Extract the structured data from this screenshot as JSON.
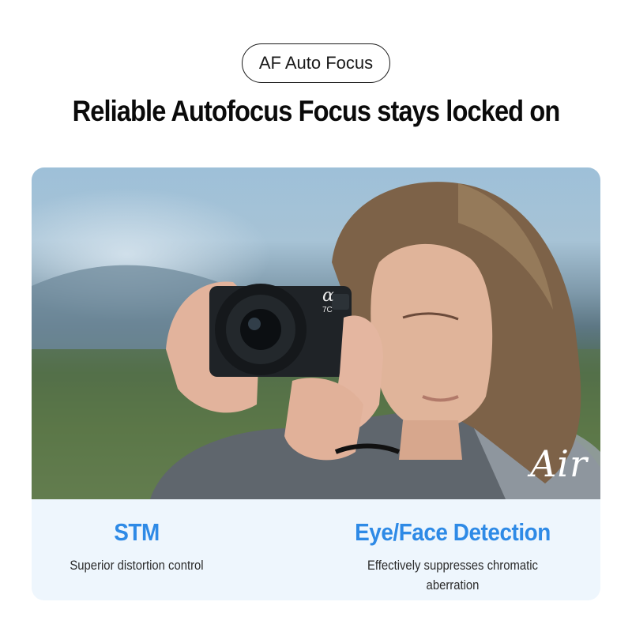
{
  "badge": {
    "label": "AF Auto Focus"
  },
  "headline": {
    "text": "Reliable Autofocus Focus stays locked on"
  },
  "photo": {
    "watermark": "Air",
    "camera_brand_mark": "α",
    "camera_model_mark": "7C"
  },
  "features": [
    {
      "title": "STM",
      "description": "Superior distortion control"
    },
    {
      "title": "Eye/Face Detection",
      "description": "Effectively suppresses chromatic aberration"
    }
  ],
  "colors": {
    "accent": "#2e8ae6",
    "card_background": "#eef6fd",
    "text_primary": "#0a0a0a"
  }
}
